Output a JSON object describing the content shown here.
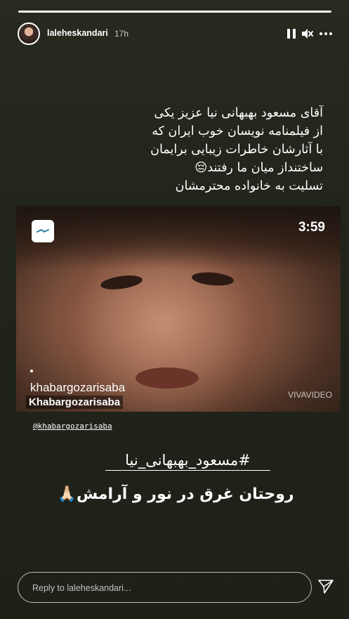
{
  "story": {
    "progress_fraction": 1,
    "username": "laleheskandari",
    "time_ago": "17h",
    "controls": {
      "pause_icon": "pause-icon",
      "mute_icon": "muted-speaker-icon",
      "more_icon": "more-horizontal-icon"
    }
  },
  "caption": {
    "lines": [
      "آقای مسعود بهبهانی نیا عزیز یکی",
      "از فیلمنامه نویسان خوب ایران که",
      "با آثارشان خاطرات زیبایی برایمان",
      "ساختنداز میان ما رفتند😔",
      "تسلیت به خانواده محترمشان"
    ]
  },
  "video": {
    "duration": "3:59",
    "channel": "khabargozarisaba",
    "watermark": "Khabargozarisaba",
    "vivavideo": "VIVAVIDEO",
    "igtv_icon": "igtv-icon"
  },
  "mention": "@khabargozarisaba",
  "hashtag": "#مسعود_بهبهانی_نیا",
  "prayer": "روحتان غرق در نور و آرامش🙏🏻",
  "reply": {
    "placeholder": "Reply to laleheskandari...",
    "send_icon": "send-icon"
  }
}
